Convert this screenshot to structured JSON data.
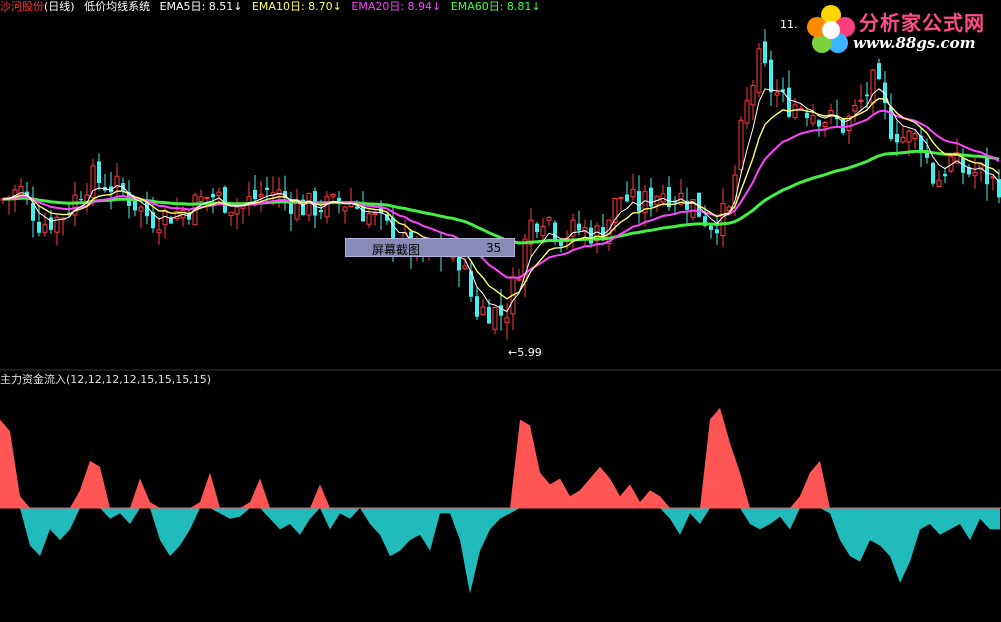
{
  "header": {
    "stock_name": "沙河股份",
    "period": "(日线)",
    "indicator": "低价均线系统",
    "ema5": "EMA5日: 8.51",
    "ema10": "EMA10日: 8.70",
    "ema20": "EMA20日: 8.94",
    "ema60": "EMA60日: 8.81",
    "arrow": "↓",
    "colors": {
      "stock_name": "#ff3030",
      "period": "#ffffff",
      "indicator": "#ffffff",
      "ema5": "#ffffff",
      "ema10": "#ffff66",
      "ema20": "#ff44ff",
      "ema60": "#44ff44"
    }
  },
  "sub_header": {
    "label": "主力资金流入(12,12,12,12,15,15,15,15)"
  },
  "watermark": {
    "title": "分析家公式网",
    "url": "www.88gs.com"
  },
  "screenshot_tag": {
    "left": "屏幕截图",
    "right": "35"
  },
  "chart_data": [
    {
      "type": "candlestick",
      "title": "",
      "annotations": {
        "high": "11.",
        "low": "←5.99"
      },
      "series": [
        {
          "name": "EMA5日",
          "color": "#ffffff"
        },
        {
          "name": "EMA10日",
          "color": "#ffff66"
        },
        {
          "name": "EMA20日",
          "color": "#ff44ff"
        },
        {
          "name": "EMA60日",
          "color": "#44ff44"
        }
      ],
      "ylim": [
        5.6,
        11.5
      ],
      "candles": [],
      "ema5": [],
      "ema10": [],
      "ema20": [],
      "ema60": []
    },
    {
      "type": "area",
      "title": "主力资金流入(12,12,12,12,15,15,15,15)",
      "colors": {
        "positive": "#ff5555",
        "negative": "#22bbbb"
      },
      "ylim": [
        -100,
        100
      ],
      "x": [
        0,
        10,
        20,
        30,
        40,
        50,
        60,
        70,
        80,
        90,
        100,
        110,
        120,
        130,
        140,
        150,
        160,
        170,
        180,
        190,
        200,
        210,
        220,
        230,
        240,
        250,
        260,
        270,
        280,
        290,
        300,
        310,
        320,
        330,
        340,
        350,
        360,
        370,
        380,
        390,
        400,
        410,
        420,
        430,
        440,
        450,
        460,
        470,
        480,
        490,
        500,
        510,
        520,
        530,
        540,
        550,
        560,
        570,
        580,
        590,
        600,
        610,
        620,
        630,
        640,
        650,
        660,
        670,
        680,
        690,
        700,
        710,
        720,
        730,
        740,
        750,
        760,
        770,
        780,
        790,
        800,
        810,
        820,
        830,
        840,
        850,
        860,
        870,
        880,
        890,
        900,
        910,
        920,
        930,
        940,
        950,
        960,
        970,
        980,
        990,
        1000
      ],
      "values": [
        75,
        65,
        10,
        -35,
        -45,
        -20,
        -30,
        -20,
        15,
        40,
        35,
        -10,
        -5,
        -15,
        25,
        5,
        -30,
        -45,
        -35,
        -20,
        5,
        30,
        -5,
        -10,
        -8,
        5,
        25,
        -10,
        -20,
        -15,
        -25,
        -10,
        20,
        -20,
        -5,
        -10,
        0,
        -15,
        -25,
        -45,
        -40,
        -30,
        -25,
        -40,
        -5,
        -5,
        -30,
        -80,
        -40,
        -20,
        -10,
        -5,
        75,
        70,
        30,
        20,
        25,
        10,
        15,
        25,
        35,
        25,
        10,
        20,
        5,
        15,
        10,
        -10,
        -25,
        -5,
        -15,
        75,
        85,
        55,
        30,
        -15,
        -20,
        -15,
        -8,
        -20,
        10,
        30,
        40,
        -5,
        -30,
        -45,
        -50,
        -30,
        -35,
        -45,
        -70,
        -50,
        -20,
        -15,
        -25,
        -20,
        -15,
        -30,
        -10,
        -20,
        -20
      ]
    }
  ]
}
